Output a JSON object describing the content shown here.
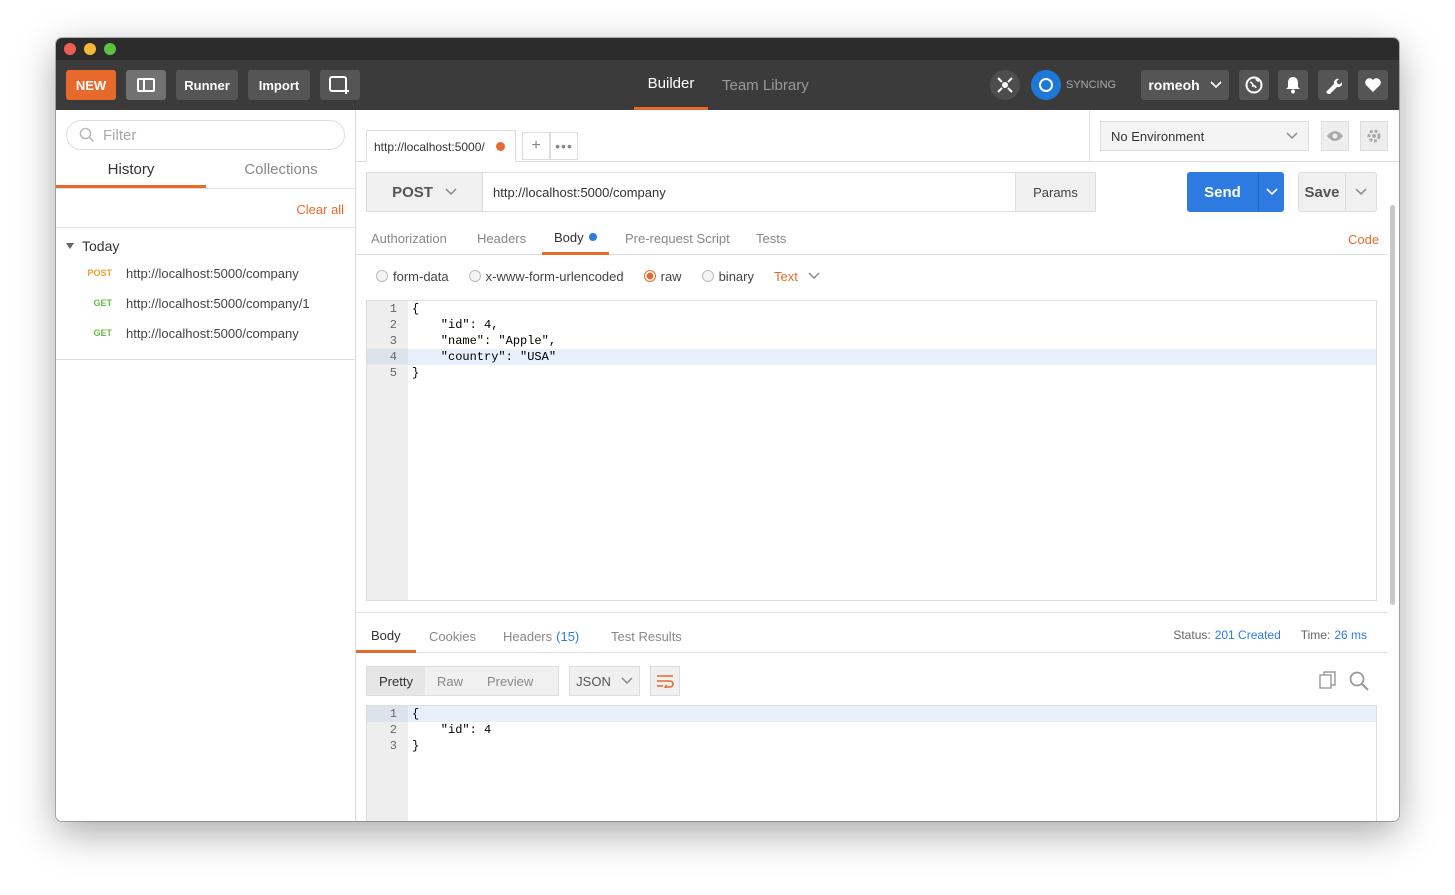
{
  "header": {
    "new_label": "NEW",
    "runner_label": "Runner",
    "import_label": "Import",
    "tabs": [
      {
        "label": "Builder",
        "active": true
      },
      {
        "label": "Team Library",
        "active": false
      }
    ],
    "sync_label": "SYNCING",
    "user_label": "romeoh",
    "accent_color": "#e8692c"
  },
  "sidebar": {
    "filter_placeholder": "Filter",
    "tabs": [
      {
        "label": "History",
        "active": true
      },
      {
        "label": "Collections",
        "active": false
      }
    ],
    "clear_all_label": "Clear all",
    "group_label": "Today",
    "items": [
      {
        "method": "POST",
        "url": "http://localhost:5000/company"
      },
      {
        "method": "GET",
        "url": "http://localhost:5000/company/1"
      },
      {
        "method": "GET",
        "url": "http://localhost:5000/company"
      }
    ]
  },
  "request_tab": {
    "label": "http://localhost:5000/"
  },
  "environment": {
    "selected": "No Environment"
  },
  "request": {
    "method": "POST",
    "url": "http://localhost:5000/company",
    "params_label": "Params",
    "send_label": "Send",
    "save_label": "Save",
    "subtabs": [
      {
        "label": "Authorization",
        "active": false
      },
      {
        "label": "Headers",
        "active": false
      },
      {
        "label": "Body",
        "active": true
      },
      {
        "label": "Pre-request Script",
        "active": false
      },
      {
        "label": "Tests",
        "active": false
      }
    ],
    "code_label": "Code",
    "body_modes": [
      {
        "label": "form-data",
        "selected": false
      },
      {
        "label": "x-www-form-urlencoded",
        "selected": false
      },
      {
        "label": "raw",
        "selected": true
      },
      {
        "label": "binary",
        "selected": false
      }
    ],
    "raw_type": "Text",
    "body_lines": [
      {
        "n": "1",
        "text": "{"
      },
      {
        "n": "2",
        "text": "    \"id\": 4,"
      },
      {
        "n": "3",
        "text": "    \"name\": \"Apple\","
      },
      {
        "n": "4",
        "text": "    \"country\": \"USA\""
      },
      {
        "n": "5",
        "text": "}"
      }
    ]
  },
  "response": {
    "tabs": [
      {
        "label": "Body",
        "active": true
      },
      {
        "label": "Cookies",
        "active": false
      },
      {
        "label": "Headers",
        "count": "(15)",
        "active": false
      },
      {
        "label": "Test Results",
        "active": false
      }
    ],
    "status_label": "Status:",
    "status_value": "201 Created",
    "time_label": "Time:",
    "time_value": "26 ms",
    "view_modes": [
      {
        "label": "Pretty",
        "active": true
      },
      {
        "label": "Raw",
        "active": false
      },
      {
        "label": "Preview",
        "active": false
      }
    ],
    "format": "JSON",
    "body_lines": [
      {
        "n": "1",
        "text": "{"
      },
      {
        "n": "2",
        "text": "    \"id\": 4"
      },
      {
        "n": "3",
        "text": "}"
      }
    ]
  }
}
